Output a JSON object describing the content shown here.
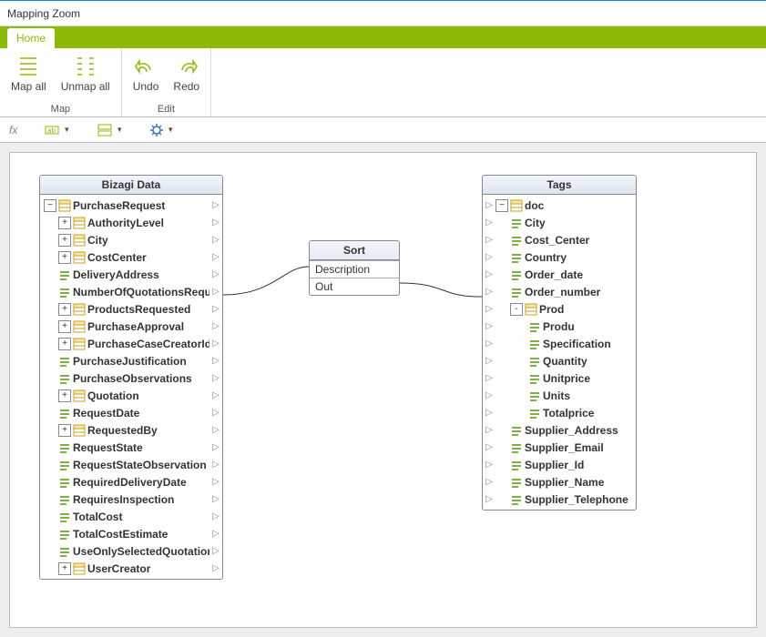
{
  "window": {
    "title": "Mapping Zoom"
  },
  "tabs": {
    "home": "Home"
  },
  "ribbon": {
    "map_group": "Map",
    "edit_group": "Edit",
    "map_all": "Map all",
    "unmap_all": "Unmap all",
    "undo": "Undo",
    "redo": "Redo"
  },
  "subtoolbar": {
    "fx": "fx"
  },
  "left_panel": {
    "title": "Bizagi Data",
    "root": "PurchaseRequest",
    "items": [
      {
        "label": "AuthorityLevel",
        "expand": "+",
        "icon": "entity"
      },
      {
        "label": "City",
        "expand": "+",
        "icon": "entity"
      },
      {
        "label": "CostCenter",
        "expand": "+",
        "icon": "entity"
      },
      {
        "label": "DeliveryAddress",
        "icon": "text"
      },
      {
        "label": "NumberOfQuotationsRequir",
        "icon": "text"
      },
      {
        "label": "ProductsRequested",
        "expand": "+",
        "icon": "list"
      },
      {
        "label": "PurchaseApproval",
        "expand": "+",
        "icon": "entity"
      },
      {
        "label": "PurchaseCaseCreatorId",
        "expand": "+",
        "icon": "entity"
      },
      {
        "label": "PurchaseJustification",
        "icon": "text"
      },
      {
        "label": "PurchaseObservations",
        "icon": "text"
      },
      {
        "label": "Quotation",
        "expand": "+",
        "icon": "list"
      },
      {
        "label": "RequestDate",
        "icon": "text"
      },
      {
        "label": "RequestedBy",
        "expand": "+",
        "icon": "entity"
      },
      {
        "label": "RequestState",
        "icon": "text"
      },
      {
        "label": "RequestStateObservation",
        "icon": "text"
      },
      {
        "label": "RequiredDeliveryDate",
        "icon": "text"
      },
      {
        "label": "RequiresInspection",
        "icon": "text"
      },
      {
        "label": "TotalCost",
        "icon": "text"
      },
      {
        "label": "TotalCostEstimate",
        "icon": "text"
      },
      {
        "label": "UseOnlySelectedQuotation",
        "icon": "text"
      },
      {
        "label": "UserCreator",
        "expand": "+",
        "icon": "entity"
      }
    ]
  },
  "mid_panel": {
    "title": "Sort",
    "row1": "Description",
    "row2": "Out"
  },
  "right_panel": {
    "title": "Tags",
    "root": "doc",
    "items": [
      {
        "label": "City",
        "icon": "text"
      },
      {
        "label": "Cost_Center",
        "icon": "text"
      },
      {
        "label": "Country",
        "icon": "text"
      },
      {
        "label": "Order_date",
        "icon": "text"
      },
      {
        "label": "Order_number",
        "icon": "text"
      },
      {
        "label": "Prod",
        "expand": "-",
        "icon": "list",
        "children": [
          {
            "label": "Produ",
            "icon": "text"
          },
          {
            "label": "Specification",
            "icon": "text"
          },
          {
            "label": "Quantity",
            "icon": "text"
          },
          {
            "label": "Unitprice",
            "icon": "text"
          },
          {
            "label": "Units",
            "icon": "text"
          },
          {
            "label": "Totalprice",
            "icon": "text"
          }
        ]
      },
      {
        "label": "Supplier_Address",
        "icon": "text"
      },
      {
        "label": "Supplier_Email",
        "icon": "text"
      },
      {
        "label": "Supplier_Id",
        "icon": "text"
      },
      {
        "label": "Supplier_Name",
        "icon": "text"
      },
      {
        "label": "Supplier_Telephone",
        "icon": "text"
      }
    ]
  }
}
